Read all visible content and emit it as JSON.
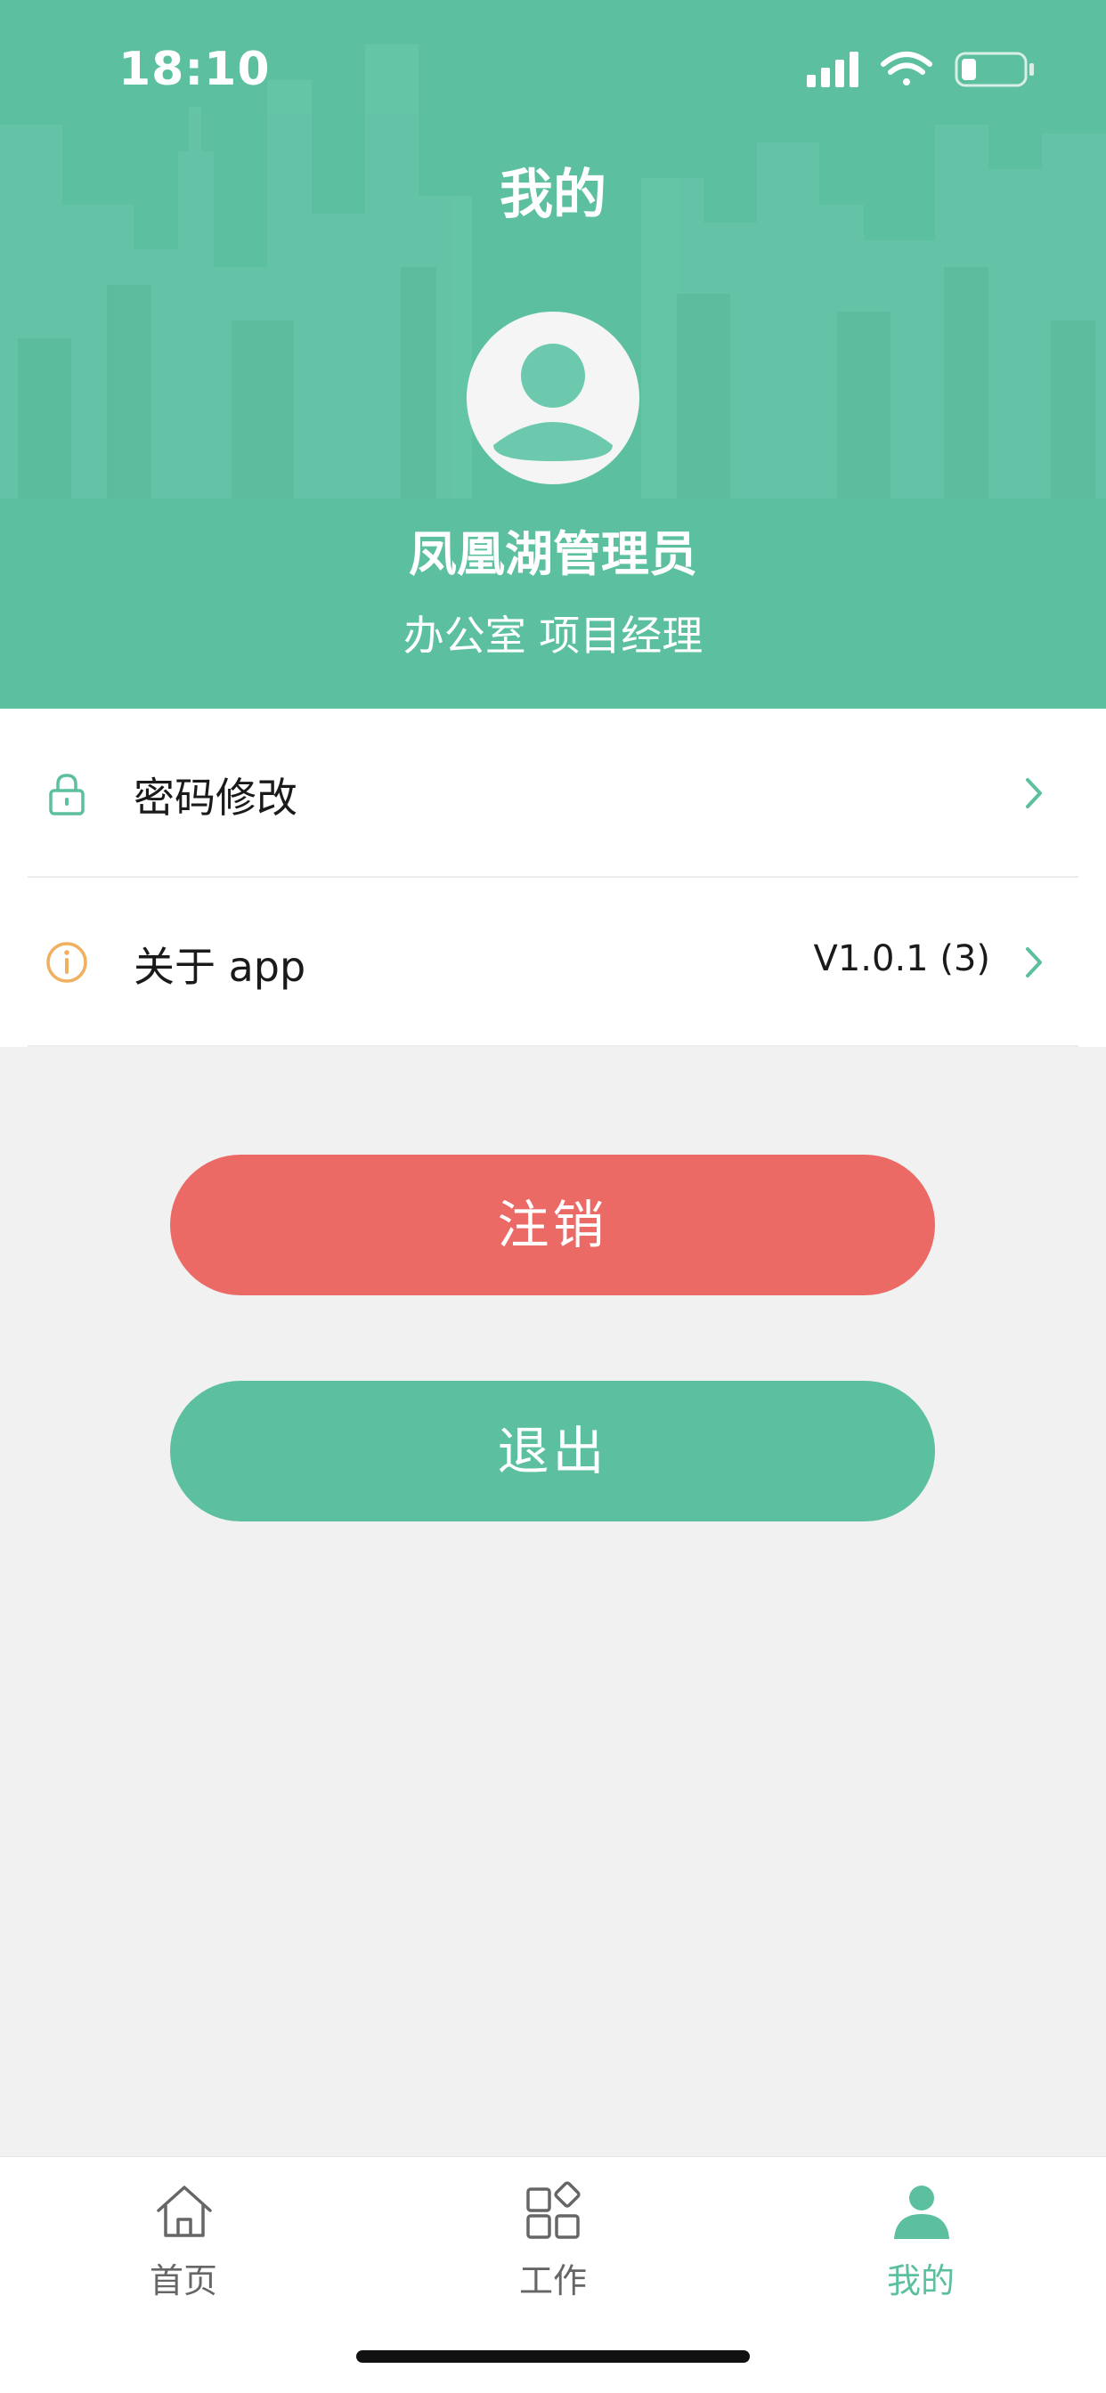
{
  "status_bar": {
    "time": "18:10"
  },
  "header": {
    "title": "我的"
  },
  "profile": {
    "name": "凤凰湖管理员",
    "role": "办公室 项目经理"
  },
  "menu": {
    "items": [
      {
        "label": "密码修改",
        "icon": "lock-icon",
        "value": ""
      },
      {
        "label": "关于 app",
        "icon": "info-icon",
        "value": "V1.0.1 (3)"
      }
    ]
  },
  "buttons": {
    "logout_label": "注销",
    "exit_label": "退出"
  },
  "tabbar": {
    "tabs": [
      {
        "label": "首页",
        "icon": "home-icon",
        "active": false
      },
      {
        "label": "工作",
        "icon": "grid-icon",
        "active": false
      },
      {
        "label": "我的",
        "icon": "person-icon",
        "active": true
      }
    ]
  },
  "colors": {
    "accent": "#5bbfa0",
    "danger": "#ec6a65",
    "info_icon": "#f0b060",
    "background": "#f1f1f1"
  }
}
